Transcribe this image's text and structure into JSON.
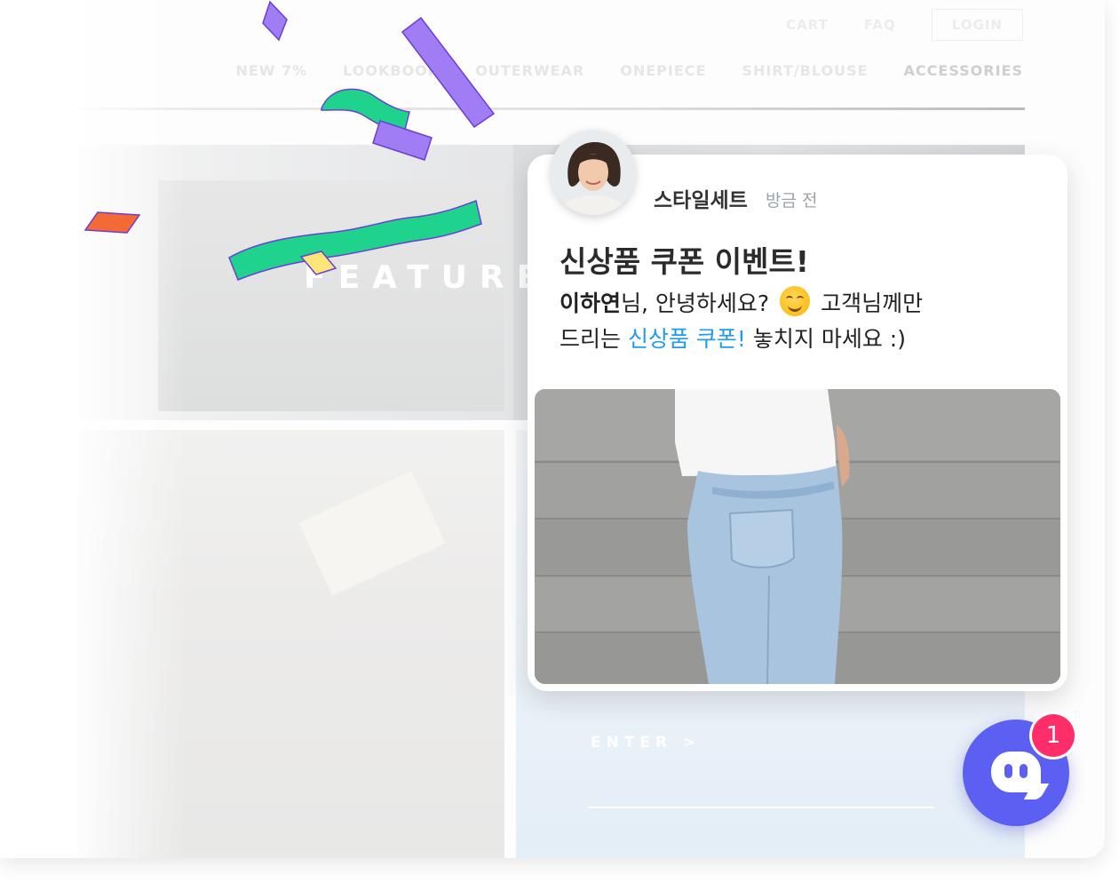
{
  "shop": {
    "topbar": {
      "cart": "CART",
      "faq": "FAQ",
      "login": "LOGIN"
    },
    "nav": [
      "NEW 7%",
      "LOOKBOOK",
      "OUTERWEAR",
      "ONEPIECE",
      "SHIRT/BLOUSE",
      "ACCESSORIES"
    ],
    "hero_label": "FEATURED",
    "enter_label": "ENTER >"
  },
  "popup": {
    "sender": "스타일세트",
    "time": "방금 전",
    "title": "신상품 쿠폰 이벤트!",
    "message": {
      "name": "이하연",
      "greeting": "님, 안녕하세요?",
      "after_emoji": "고객님께만",
      "line2_prefix": "드리는",
      "coupon_link": "신상품 쿠폰!",
      "line2_suffix": "놓치지 마세요 :)"
    }
  },
  "launcher": {
    "badge_count": "1"
  },
  "colors": {
    "accent": "#5b5ff2",
    "badge": "#ff2d6a",
    "link": "#1f9bf0",
    "confetti_purple": "#a07cf5",
    "confetti_green": "#1fd38d",
    "confetti_orange": "#f46a37",
    "confetti_yellow": "#fde579"
  }
}
